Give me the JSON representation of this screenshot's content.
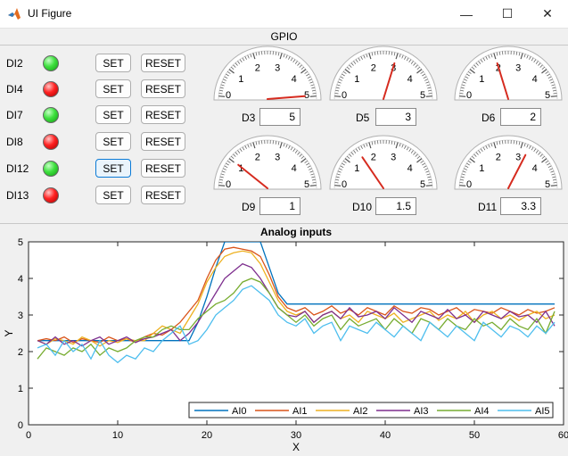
{
  "window": {
    "title": "UI Figure",
    "minimize_glyph": "—",
    "maximize_glyph": "☐",
    "close_glyph": "✕"
  },
  "gpio": {
    "title": "GPIO",
    "inputs": [
      {
        "label": "DI2",
        "state": "on"
      },
      {
        "label": "DI4",
        "state": "off"
      },
      {
        "label": "DI7",
        "state": "on"
      },
      {
        "label": "DI8",
        "state": "off"
      },
      {
        "label": "DI12",
        "state": "on"
      },
      {
        "label": "DI13",
        "state": "off"
      }
    ],
    "set_label": "SET",
    "reset_label": "RESET",
    "gauges": [
      {
        "label": "D3",
        "value": "5",
        "needle": 5
      },
      {
        "label": "D5",
        "value": "3",
        "needle": 3
      },
      {
        "label": "D6",
        "value": "2",
        "needle": 2
      },
      {
        "label": "D9",
        "value": "1",
        "needle": 1
      },
      {
        "label": "D10",
        "value": "1.5",
        "needle": 1.5
      },
      {
        "label": "D11",
        "value": "3.3",
        "needle": 3.3
      }
    ],
    "gauge_ticks": [
      "0",
      "1",
      "2",
      "3",
      "4",
      "5"
    ]
  },
  "colors": {
    "led_on": "#22cc22",
    "led_off": "#ee1111",
    "needle": "#d62b1f",
    "focus": "#0a7ad6"
  },
  "chart_data": {
    "type": "line",
    "title": "Analog inputs",
    "xlabel": "X",
    "ylabel": "Y",
    "xlim": [
      0,
      60
    ],
    "ylim": [
      0,
      5
    ],
    "xticks": [
      "0",
      "10",
      "20",
      "30",
      "40",
      "50",
      "60"
    ],
    "yticks": [
      "0",
      "1",
      "2",
      "3",
      "4",
      "5"
    ],
    "grid": false,
    "legend_position": "bottom-right",
    "series": [
      {
        "name": "AI0",
        "color": "#0072bd",
        "x": [
          1,
          2,
          3,
          4,
          5,
          6,
          7,
          8,
          9,
          10,
          11,
          12,
          13,
          14,
          15,
          16,
          17,
          18,
          19,
          20,
          21,
          22,
          23,
          24,
          25,
          26,
          27,
          28,
          29,
          30,
          31,
          32,
          33,
          34,
          35,
          36,
          37,
          38,
          39,
          40,
          41,
          42,
          43,
          44,
          45,
          46,
          47,
          48,
          49,
          50,
          51,
          52,
          53,
          54,
          55,
          56,
          57,
          58,
          59
        ],
        "y": [
          2.3,
          2.3,
          2.3,
          2.3,
          2.3,
          2.3,
          2.3,
          2.3,
          2.3,
          2.3,
          2.3,
          2.3,
          2.3,
          2.3,
          2.3,
          2.3,
          2.3,
          2.3,
          2.8,
          3.5,
          4.3,
          5,
          5,
          5,
          5,
          5,
          4.3,
          3.6,
          3.3,
          3.3,
          3.3,
          3.3,
          3.3,
          3.3,
          3.3,
          3.3,
          3.3,
          3.3,
          3.3,
          3.3,
          3.3,
          3.3,
          3.3,
          3.3,
          3.3,
          3.3,
          3.3,
          3.3,
          3.3,
          3.3,
          3.3,
          3.3,
          3.3,
          3.3,
          3.3,
          3.3,
          3.3,
          3.3,
          3.3
        ]
      },
      {
        "name": "AI1",
        "color": "#d95319",
        "x": [
          1,
          2,
          3,
          4,
          5,
          6,
          7,
          8,
          9,
          10,
          11,
          12,
          13,
          14,
          15,
          16,
          17,
          18,
          19,
          20,
          21,
          22,
          23,
          24,
          25,
          26,
          27,
          28,
          29,
          30,
          31,
          32,
          33,
          34,
          35,
          36,
          37,
          38,
          39,
          40,
          41,
          42,
          43,
          44,
          45,
          46,
          47,
          48,
          49,
          50,
          51,
          52,
          53,
          54,
          55,
          56,
          57,
          58,
          59
        ],
        "y": [
          2.3,
          2.35,
          2.3,
          2.4,
          2.25,
          2.35,
          2.3,
          2.25,
          2.4,
          2.3,
          2.35,
          2.25,
          2.4,
          2.5,
          2.45,
          2.6,
          2.8,
          3.1,
          3.4,
          4.0,
          4.5,
          4.8,
          4.85,
          4.8,
          4.75,
          4.6,
          4.1,
          3.5,
          3.2,
          3.1,
          3.2,
          3.0,
          3.1,
          3.25,
          3.05,
          3.15,
          3.0,
          3.2,
          3.1,
          3.0,
          3.25,
          3.1,
          3.05,
          3.2,
          3.15,
          3.0,
          3.1,
          3.2,
          3.0,
          3.15,
          3.1,
          3.05,
          3.2,
          3.1,
          3.0,
          3.15,
          3.05,
          3.1,
          3.2
        ]
      },
      {
        "name": "AI2",
        "color": "#edb120",
        "x": [
          1,
          2,
          3,
          4,
          5,
          6,
          7,
          8,
          9,
          10,
          11,
          12,
          13,
          14,
          15,
          16,
          17,
          18,
          19,
          20,
          21,
          22,
          23,
          24,
          25,
          26,
          27,
          28,
          29,
          30,
          31,
          32,
          33,
          34,
          35,
          36,
          37,
          38,
          39,
          40,
          41,
          42,
          43,
          44,
          45,
          46,
          47,
          48,
          49,
          50,
          51,
          52,
          53,
          54,
          55,
          56,
          57,
          58,
          59
        ],
        "y": [
          2.3,
          2.2,
          2.35,
          2.3,
          2.2,
          2.4,
          2.3,
          2.15,
          2.3,
          2.25,
          2.35,
          2.3,
          2.3,
          2.5,
          2.7,
          2.6,
          2.5,
          2.9,
          3.3,
          3.9,
          4.3,
          4.6,
          4.7,
          4.75,
          4.7,
          4.4,
          3.9,
          3.4,
          3.1,
          3.0,
          3.1,
          2.8,
          3.0,
          3.1,
          2.9,
          3.0,
          2.8,
          3.1,
          3.0,
          2.9,
          3.05,
          2.8,
          2.9,
          3.0,
          3.1,
          2.85,
          3.0,
          2.9,
          3.1,
          2.8,
          3.0,
          3.1,
          2.9,
          3.0,
          2.85,
          3.0,
          3.1,
          2.9,
          3.0
        ]
      },
      {
        "name": "AI3",
        "color": "#7e2f8e",
        "x": [
          1,
          2,
          3,
          4,
          5,
          6,
          7,
          8,
          9,
          10,
          11,
          12,
          13,
          14,
          15,
          16,
          17,
          18,
          19,
          20,
          21,
          22,
          23,
          24,
          25,
          26,
          27,
          28,
          29,
          30,
          31,
          32,
          33,
          34,
          35,
          36,
          37,
          38,
          39,
          40,
          41,
          42,
          43,
          44,
          45,
          46,
          47,
          48,
          49,
          50,
          51,
          52,
          53,
          54,
          55,
          56,
          57,
          58,
          59
        ],
        "y": [
          2.3,
          2.2,
          2.4,
          2.2,
          2.3,
          2.15,
          2.3,
          2.4,
          2.2,
          2.3,
          2.4,
          2.25,
          2.35,
          2.4,
          2.5,
          2.6,
          2.3,
          2.5,
          2.8,
          3.2,
          3.6,
          4.0,
          4.2,
          4.4,
          4.3,
          4.0,
          3.6,
          3.2,
          3.0,
          2.95,
          3.1,
          2.8,
          3.0,
          3.1,
          2.9,
          3.2,
          2.95,
          3.0,
          3.1,
          2.9,
          3.2,
          3.0,
          2.8,
          3.1,
          3.0,
          2.9,
          3.15,
          2.9,
          3.0,
          2.8,
          3.1,
          3.0,
          2.9,
          3.1,
          2.95,
          3.0,
          2.8,
          3.1,
          2.7
        ]
      },
      {
        "name": "AI4",
        "color": "#77ac30",
        "x": [
          1,
          2,
          3,
          4,
          5,
          6,
          7,
          8,
          9,
          10,
          11,
          12,
          13,
          14,
          15,
          16,
          17,
          18,
          19,
          20,
          21,
          22,
          23,
          24,
          25,
          26,
          27,
          28,
          29,
          30,
          31,
          32,
          33,
          34,
          35,
          36,
          37,
          38,
          39,
          40,
          41,
          42,
          43,
          44,
          45,
          46,
          47,
          48,
          49,
          50,
          51,
          52,
          53,
          54,
          55,
          56,
          57,
          58,
          59
        ],
        "y": [
          1.8,
          2.1,
          2.0,
          1.9,
          2.1,
          2.0,
          2.2,
          1.9,
          2.1,
          2.0,
          2.1,
          2.3,
          2.4,
          2.4,
          2.6,
          2.7,
          2.6,
          2.6,
          2.9,
          3.1,
          3.3,
          3.4,
          3.6,
          3.9,
          4.0,
          3.9,
          3.6,
          3.2,
          3.0,
          2.8,
          3.0,
          2.7,
          2.9,
          3.0,
          2.6,
          2.9,
          2.7,
          2.8,
          2.9,
          2.6,
          2.9,
          2.7,
          2.5,
          2.9,
          2.8,
          2.6,
          2.9,
          2.7,
          2.6,
          2.9,
          2.7,
          2.8,
          2.6,
          2.9,
          2.7,
          2.6,
          2.9,
          2.5,
          3.1
        ]
      },
      {
        "name": "AI5",
        "color": "#4dbeee",
        "x": [
          1,
          2,
          3,
          4,
          5,
          6,
          7,
          8,
          9,
          10,
          11,
          12,
          13,
          14,
          15,
          16,
          17,
          18,
          19,
          20,
          21,
          22,
          23,
          24,
          25,
          26,
          27,
          28,
          29,
          30,
          31,
          32,
          33,
          34,
          35,
          36,
          37,
          38,
          39,
          40,
          41,
          42,
          43,
          44,
          45,
          46,
          47,
          48,
          49,
          50,
          51,
          52,
          53,
          54,
          55,
          56,
          57,
          58,
          59
        ],
        "y": [
          2.1,
          2.2,
          1.9,
          2.3,
          2.0,
          2.2,
          1.8,
          2.3,
          1.9,
          1.7,
          1.9,
          1.8,
          2.1,
          2.0,
          2.3,
          2.5,
          2.7,
          2.2,
          2.3,
          2.6,
          3.0,
          3.2,
          3.4,
          3.7,
          3.8,
          3.6,
          3.4,
          3.0,
          2.8,
          2.7,
          2.9,
          2.5,
          2.7,
          2.8,
          2.3,
          2.7,
          2.6,
          2.5,
          2.8,
          2.6,
          2.4,
          2.7,
          2.5,
          2.3,
          2.8,
          2.6,
          2.4,
          2.7,
          2.5,
          2.3,
          2.8,
          2.6,
          2.4,
          2.7,
          2.6,
          2.4,
          2.7,
          2.5,
          2.8
        ]
      }
    ]
  }
}
